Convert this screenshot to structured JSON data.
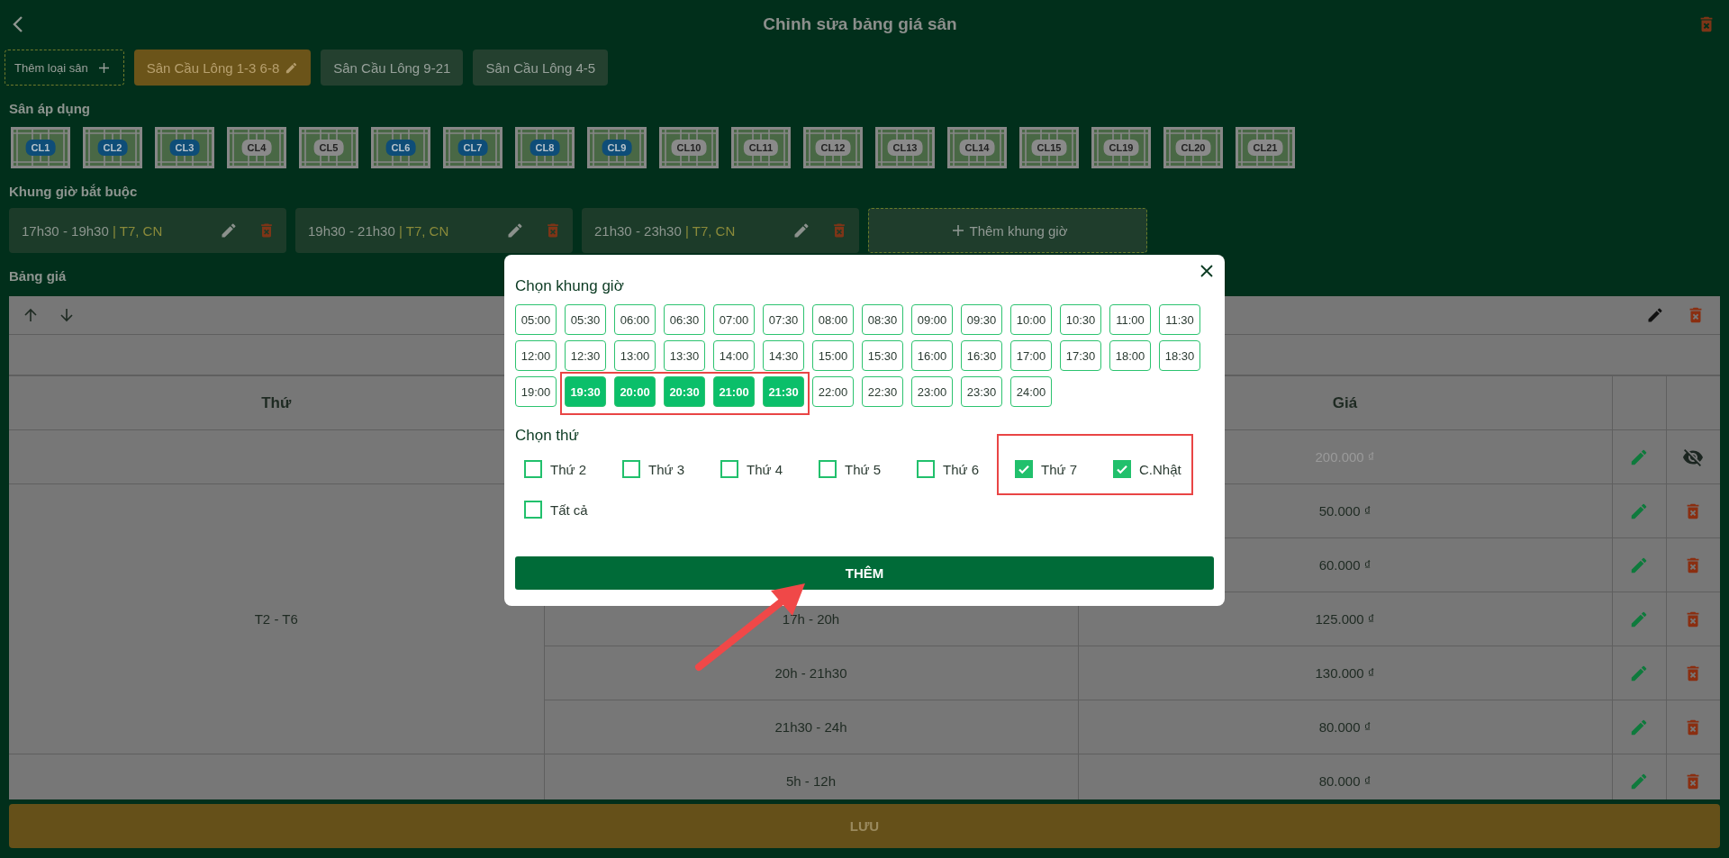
{
  "header": {
    "title": "Chỉnh sửa bảng giá sân"
  },
  "add_court_type_button": {
    "label": "Thêm loại sân"
  },
  "court_types": [
    {
      "label": "Sân Cầu Lông 1-3 6-8",
      "selected": true
    },
    {
      "label": "Sân Cầu Lông 9-21",
      "selected": false
    },
    {
      "label": "Sân Cầu Lông 4-5",
      "selected": false
    }
  ],
  "courts_section": {
    "label": "Sân áp dụng"
  },
  "courts": [
    {
      "name": "CL1",
      "selected": true
    },
    {
      "name": "CL2",
      "selected": true
    },
    {
      "name": "CL3",
      "selected": true
    },
    {
      "name": "CL4",
      "selected": false
    },
    {
      "name": "CL5",
      "selected": false
    },
    {
      "name": "CL6",
      "selected": true
    },
    {
      "name": "CL7",
      "selected": true
    },
    {
      "name": "CL8",
      "selected": true
    },
    {
      "name": "CL9",
      "selected": true
    },
    {
      "name": "CL10",
      "selected": false
    },
    {
      "name": "CL11",
      "selected": false
    },
    {
      "name": "CL12",
      "selected": false
    },
    {
      "name": "CL13",
      "selected": false
    },
    {
      "name": "CL14",
      "selected": false
    },
    {
      "name": "CL15",
      "selected": false
    },
    {
      "name": "CL19",
      "selected": false
    },
    {
      "name": "CL20",
      "selected": false
    },
    {
      "name": "CL21",
      "selected": false
    }
  ],
  "time_slots_section": {
    "label": "Khung giờ bắt buộc"
  },
  "time_slots": [
    {
      "time": "17h30 - 19h30",
      "days": "| T7, CN"
    },
    {
      "time": "19h30 - 21h30",
      "days": "| T7, CN"
    },
    {
      "time": "21h30 - 23h30",
      "days": "| T7, CN"
    }
  ],
  "add_time_slot_button": {
    "label": "Thêm khung giờ"
  },
  "price_section": {
    "label": "Bảng giá"
  },
  "table": {
    "day_heading": "Thứ",
    "price_heading": "Giá",
    "groups": [
      {
        "rows": [
          {
            "price": "200.000 ₫",
            "hidden": true
          }
        ]
      },
      {
        "day": "T2 - T6",
        "rows": [
          {
            "price": "50.000 ₫",
            "hidden": false
          },
          {
            "price": "60.000 ₫",
            "hidden": false
          },
          {
            "time": "17h - 20h",
            "price": "125.000 ₫",
            "hidden": false
          },
          {
            "time": "20h - 21h30",
            "price": "130.000 ₫",
            "hidden": false
          },
          {
            "time": "21h30 - 24h",
            "price": "80.000 ₫",
            "hidden": false
          }
        ]
      },
      {
        "rows": [
          {
            "time": "5h - 12h",
            "price": "80.000 ₫",
            "hidden": false
          }
        ]
      }
    ]
  },
  "save_button": {
    "label": "LƯU"
  },
  "modal": {
    "title": "Chọn khung giờ",
    "times": [
      {
        "label": "05:00",
        "selected": false
      },
      {
        "label": "05:30",
        "selected": false
      },
      {
        "label": "06:00",
        "selected": false
      },
      {
        "label": "06:30",
        "selected": false
      },
      {
        "label": "07:00",
        "selected": false
      },
      {
        "label": "07:30",
        "selected": false
      },
      {
        "label": "08:00",
        "selected": false
      },
      {
        "label": "08:30",
        "selected": false
      },
      {
        "label": "09:00",
        "selected": false
      },
      {
        "label": "09:30",
        "selected": false
      },
      {
        "label": "10:00",
        "selected": false
      },
      {
        "label": "10:30",
        "selected": false
      },
      {
        "label": "11:00",
        "selected": false
      },
      {
        "label": "11:30",
        "selected": false
      },
      {
        "label": "12:00",
        "selected": false
      },
      {
        "label": "12:30",
        "selected": false
      },
      {
        "label": "13:00",
        "selected": false
      },
      {
        "label": "13:30",
        "selected": false
      },
      {
        "label": "14:00",
        "selected": false
      },
      {
        "label": "14:30",
        "selected": false
      },
      {
        "label": "15:00",
        "selected": false
      },
      {
        "label": "15:30",
        "selected": false
      },
      {
        "label": "16:00",
        "selected": false
      },
      {
        "label": "16:30",
        "selected": false
      },
      {
        "label": "17:00",
        "selected": false
      },
      {
        "label": "17:30",
        "selected": false
      },
      {
        "label": "18:00",
        "selected": false
      },
      {
        "label": "18:30",
        "selected": false
      },
      {
        "label": "19:00",
        "selected": false
      },
      {
        "label": "19:30",
        "selected": true
      },
      {
        "label": "20:00",
        "selected": true
      },
      {
        "label": "20:30",
        "selected": true
      },
      {
        "label": "21:00",
        "selected": true
      },
      {
        "label": "21:30",
        "selected": true
      },
      {
        "label": "22:00",
        "selected": false
      },
      {
        "label": "22:30",
        "selected": false
      },
      {
        "label": "23:00",
        "selected": false
      },
      {
        "label": "23:30",
        "selected": false
      },
      {
        "label": "24:00",
        "selected": false
      }
    ],
    "days_title": "Chọn thứ",
    "days": [
      {
        "label": "Thứ 2",
        "checked": false
      },
      {
        "label": "Thứ 3",
        "checked": false
      },
      {
        "label": "Thứ 4",
        "checked": false
      },
      {
        "label": "Thứ 5",
        "checked": false
      },
      {
        "label": "Thứ 6",
        "checked": false
      },
      {
        "label": "Thứ 7",
        "checked": true
      },
      {
        "label": "C.Nhật",
        "checked": true
      },
      {
        "label": "Tất cả",
        "checked": false
      }
    ],
    "submit": "THÊM"
  }
}
